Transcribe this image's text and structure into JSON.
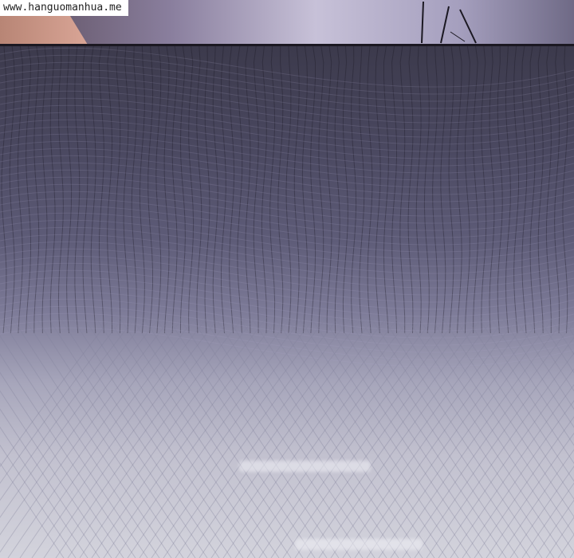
{
  "watermark": {
    "text": "www.hanguomanhua.me"
  },
  "colors": {
    "top_dark": "#3c3a4c",
    "bottom_light": "#d3d3dc",
    "divider": "#1b1822",
    "watermark_bg": "#ffffff"
  }
}
